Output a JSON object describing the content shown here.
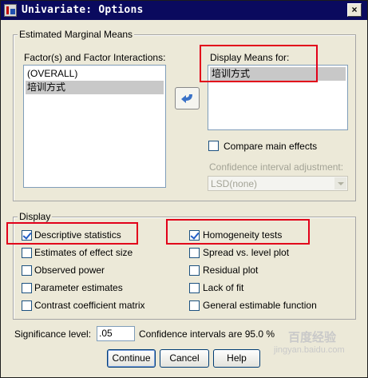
{
  "window": {
    "title": "Univariate: Options",
    "close_glyph": "×"
  },
  "emm": {
    "group_label": "Estimated Marginal Means",
    "factors_label": "Factor(s) and Factor Interactions:",
    "factors": [
      "(OVERALL)",
      "培训方式"
    ],
    "selected_factor_index": 1,
    "display_means_label": "Display Means for:",
    "display_means": [
      "培训方式"
    ],
    "move_button_icon": "curved-arrow-left-icon",
    "compare_main_effects": {
      "label": "Compare main effects",
      "checked": false
    },
    "ci_adjustment_label": "Confidence interval adjustment:",
    "ci_adjustment_value": "LSD(none)"
  },
  "display": {
    "group_label": "Display",
    "options": {
      "descriptive_statistics": {
        "label": "Descriptive statistics",
        "checked": true
      },
      "estimates_of_effect_size": {
        "label": "Estimates of effect size",
        "checked": false
      },
      "observed_power": {
        "label": "Observed power",
        "checked": false
      },
      "parameter_estimates": {
        "label": "Parameter estimates",
        "checked": false
      },
      "contrast_coefficient_matrix": {
        "label": "Contrast coefficient matrix",
        "checked": false
      },
      "homogeneity_tests": {
        "label": "Homogeneity tests",
        "checked": true
      },
      "spread_vs_level_plot": {
        "label": "Spread vs. level plot",
        "checked": false
      },
      "residual_plot": {
        "label": "Residual plot",
        "checked": false
      },
      "lack_of_fit": {
        "label": "Lack of fit",
        "checked": false
      },
      "general_estimable_function": {
        "label": "General estimable function",
        "checked": false
      }
    }
  },
  "significance": {
    "label": "Significance level:",
    "value": ".05",
    "ci_text": "Confidence intervals are 95.0 %"
  },
  "buttons": {
    "continue": "Continue",
    "cancel": "Cancel",
    "help": "Help"
  },
  "watermark": {
    "main": "百度经验",
    "sub": "jingyan.baidu.com"
  },
  "colors": {
    "title_bar": "#0a0a5e",
    "highlight": "#e2001a",
    "selection": "#c8c8c8",
    "dialog_bg": "#ece9d8"
  }
}
